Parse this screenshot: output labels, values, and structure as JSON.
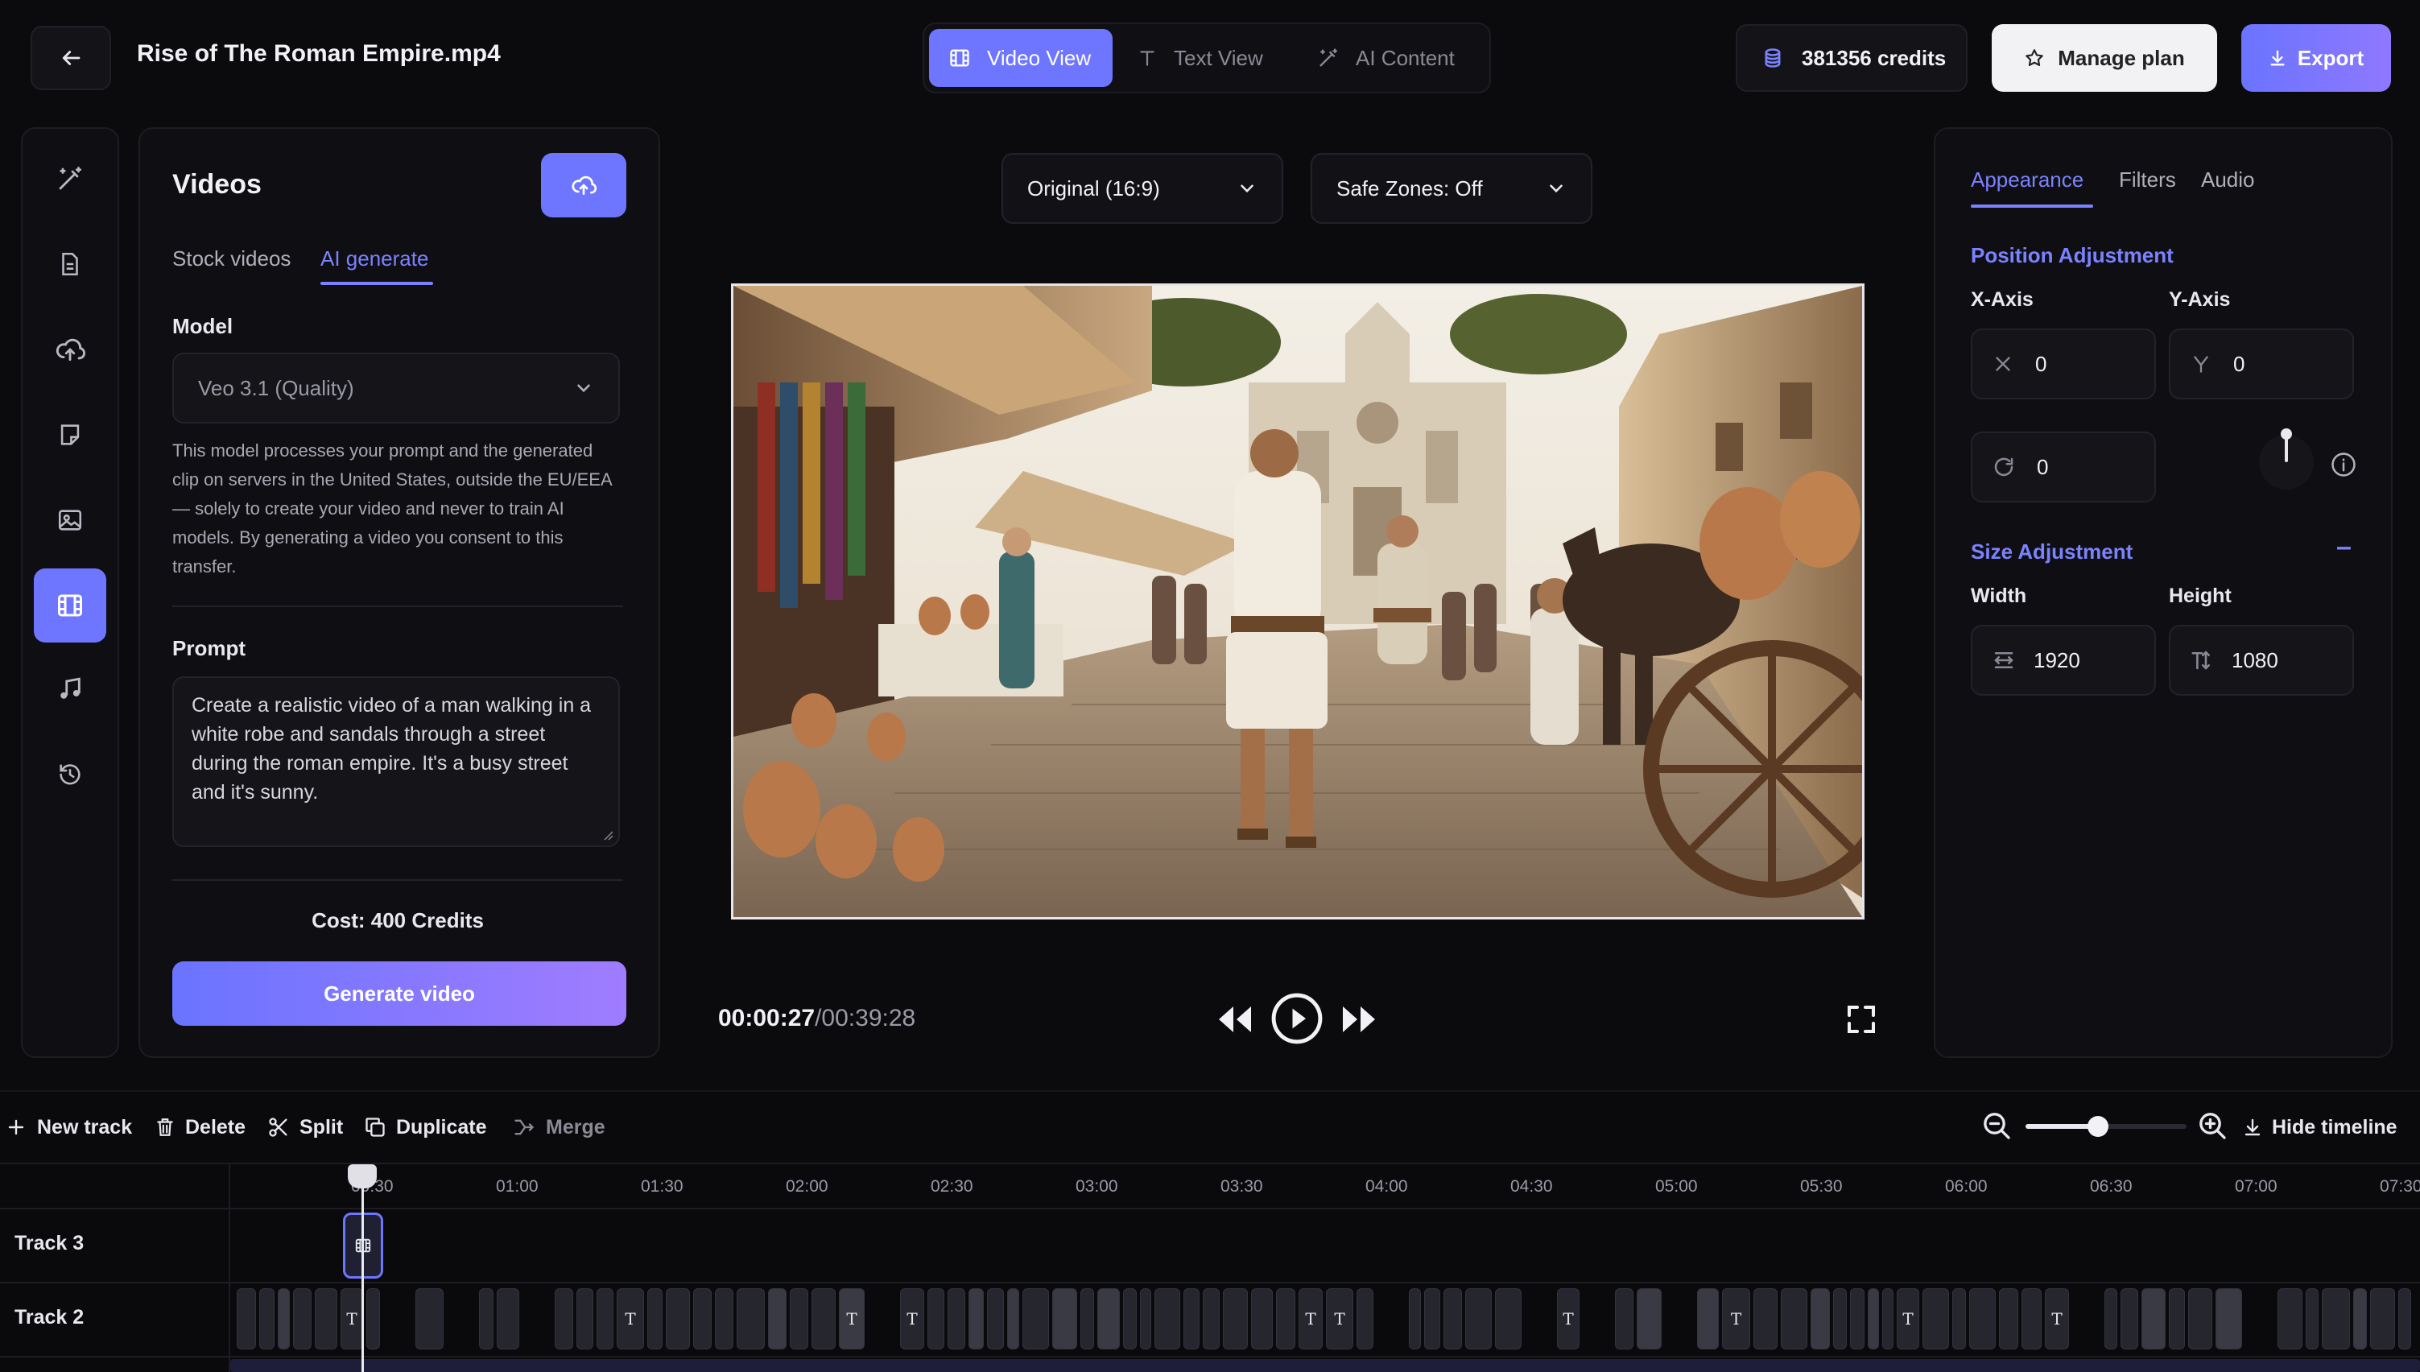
{
  "header": {
    "file_name": "Rise of The Roman Empire.mp4",
    "view_tabs": [
      "Video View",
      "Text View",
      "AI Content"
    ],
    "credits": "381356 credits",
    "manage_plan": "Manage plan",
    "export": "Export"
  },
  "left_panel": {
    "title": "Videos",
    "tabs": [
      "Stock videos",
      "AI generate"
    ],
    "model_label": "Model",
    "model_value": "Veo 3.1 (Quality)",
    "model_note": "This model processes your prompt and the generated clip on servers in the United States, outside the EU/EEA — solely to create your video and never to train AI models. By generating a video you consent to this transfer.",
    "prompt_label": "Prompt",
    "prompt_value": "Create a realistic video of a man walking in a white robe and sandals through a street during the roman empire. It's a busy street and it's sunny.",
    "cost": "Cost: 400 Credits",
    "generate": "Generate video"
  },
  "preview": {
    "aspect": "Original (16:9)",
    "safe_zones": "Safe Zones: Off",
    "time_current": "00:00:27",
    "time_total": "/00:39:28"
  },
  "right_panel": {
    "tabs": [
      "Appearance",
      "Filters",
      "Audio"
    ],
    "position_title": "Position Adjustment",
    "x_label": "X-Axis",
    "y_label": "Y-Axis",
    "x_value": "0",
    "y_value": "0",
    "rotation_value": "0",
    "size_title": "Size Adjustment",
    "collapse_symbol": "–",
    "width_label": "Width",
    "height_label": "Height",
    "width_value": "1920",
    "height_value": "1080"
  },
  "timeline": {
    "toolbar": [
      "New track",
      "Delete",
      "Split",
      "Duplicate",
      "Merge"
    ],
    "hide": "Hide timeline",
    "zoom_level": 0.45,
    "ruler": [
      "00:30",
      "01:00",
      "01:30",
      "02:00",
      "02:30",
      "03:00",
      "03:30",
      "04:00",
      "04:30",
      "05:00",
      "05:30",
      "06:00",
      "06:30",
      "07:00",
      "07:30"
    ],
    "tracks": [
      "Track 3",
      "Track 2"
    ]
  },
  "colors": {
    "accent": "#7b82ff",
    "accent_gradient_start": "#6a74ff",
    "accent_gradient_end": "#a07cff",
    "background": "#0b0b0e"
  }
}
